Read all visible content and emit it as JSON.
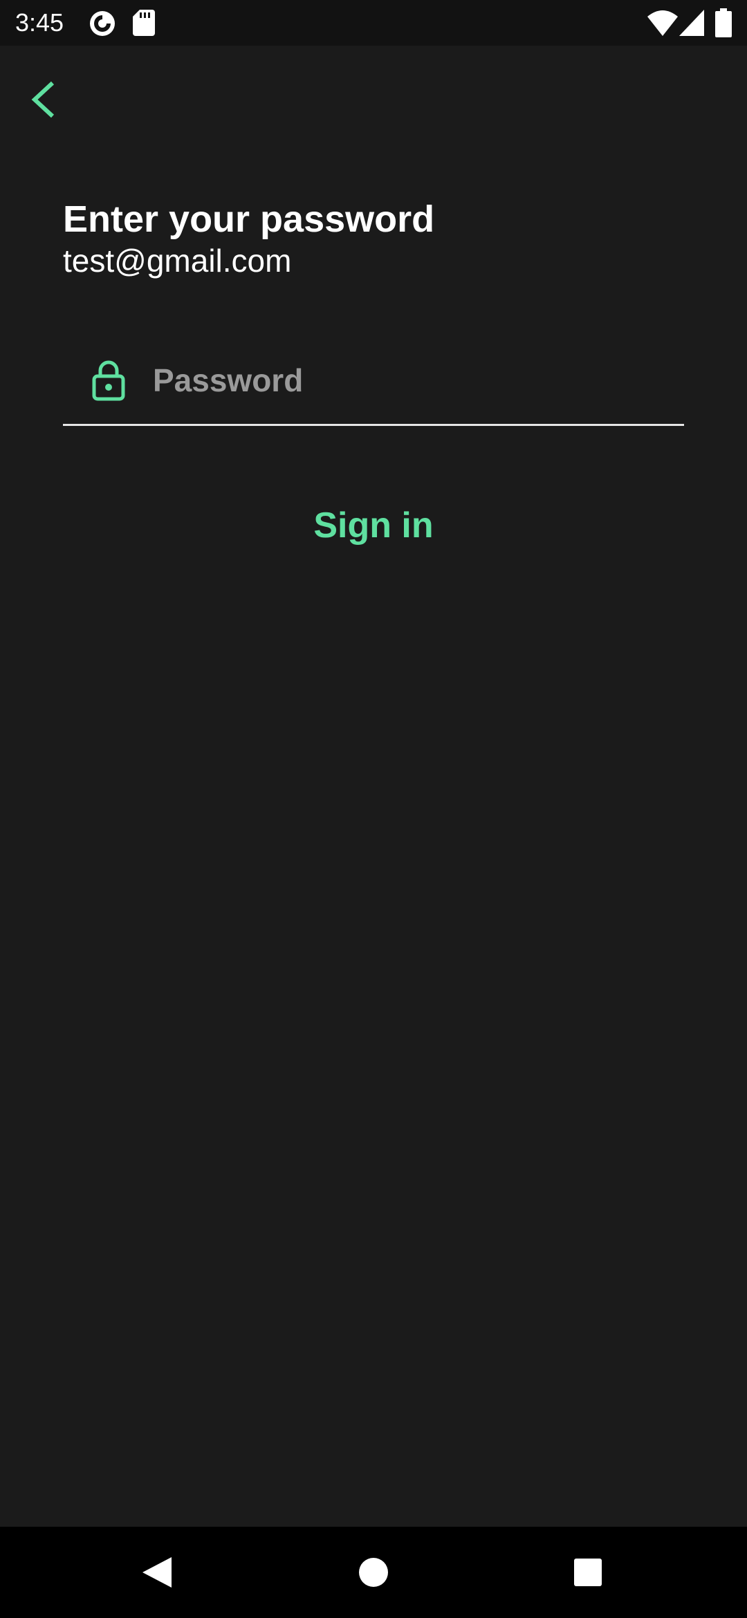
{
  "status_bar": {
    "time": "3:45",
    "icons": [
      "pocket-casts-icon",
      "sd-card-icon",
      "wifi-icon",
      "cell-signal-icon",
      "battery-icon"
    ]
  },
  "header": {
    "back_icon": "chevron-left-icon"
  },
  "main": {
    "title": "Enter your password",
    "email": "test@gmail.com",
    "password": {
      "placeholder": "Password",
      "value": "",
      "icon": "lock-icon"
    },
    "sign_in_label": "Sign in"
  },
  "nav_bar": {
    "buttons": [
      "back-triangle-icon",
      "home-circle-icon",
      "recents-square-icon"
    ]
  },
  "colors": {
    "accent": "#5fe0a0",
    "background": "#1b1b1b",
    "status_bar": "#121212",
    "nav_bar": "#000000",
    "placeholder": "#9a9a9a"
  }
}
